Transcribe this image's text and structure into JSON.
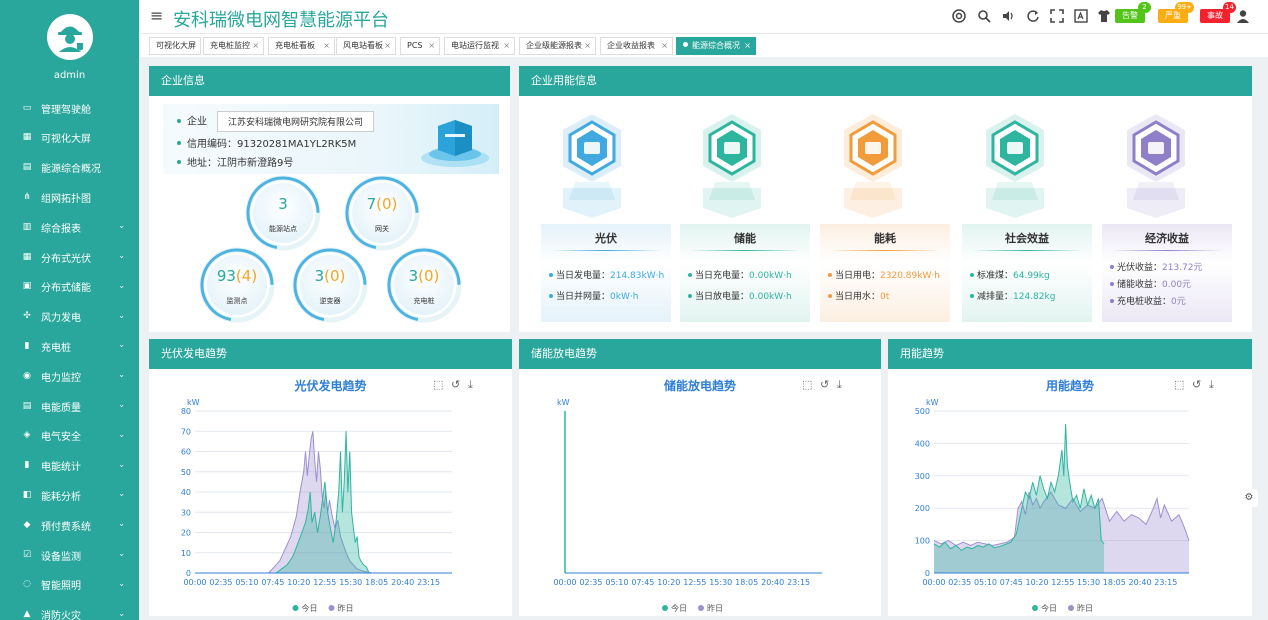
{
  "user": {
    "name": "admin"
  },
  "sidebar": {
    "items": [
      {
        "label": "管理驾驶舱",
        "icon": "monitor-icon",
        "chev": false
      },
      {
        "label": "可视化大屏",
        "icon": "screen-chart-icon",
        "chev": false
      },
      {
        "label": "能源综合概况",
        "icon": "grid-doc-icon",
        "chev": false
      },
      {
        "label": "组网拓扑图",
        "icon": "topology-icon",
        "chev": false
      },
      {
        "label": "综合报表",
        "icon": "report-icon",
        "chev": true
      },
      {
        "label": "分布式光伏",
        "icon": "solar-icon",
        "chev": true
      },
      {
        "label": "分布式储能",
        "icon": "battery-icon",
        "chev": true
      },
      {
        "label": "风力发电",
        "icon": "wind-icon",
        "chev": true
      },
      {
        "label": "充电桩",
        "icon": "charger-icon",
        "chev": true
      },
      {
        "label": "电力监控",
        "icon": "power-monitor-icon",
        "chev": true
      },
      {
        "label": "电能质量",
        "icon": "quality-icon",
        "chev": true
      },
      {
        "label": "电气安全",
        "icon": "safety-icon",
        "chev": true
      },
      {
        "label": "电能统计",
        "icon": "bar-stats-icon",
        "chev": true
      },
      {
        "label": "能耗分析",
        "icon": "analysis-icon",
        "chev": true
      },
      {
        "label": "预付费系统",
        "icon": "prepay-icon",
        "chev": true
      },
      {
        "label": "设备监测",
        "icon": "device-check-icon",
        "chev": true
      },
      {
        "label": "智能照明",
        "icon": "bulb-icon",
        "chev": true
      },
      {
        "label": "消防火灾",
        "icon": "fire-icon",
        "chev": true
      }
    ]
  },
  "header": {
    "title": "安科瑞微电网智慧能源平台",
    "badges": [
      {
        "label": "告警",
        "count": "2",
        "color": "#52c41a",
        "count_color": "#52c41a"
      },
      {
        "label": "严重",
        "count": "99+",
        "color": "#faad14",
        "count_color": "#faad14"
      },
      {
        "label": "事故",
        "count": "14",
        "color": "#f5222d",
        "count_color": "#f5222d"
      }
    ]
  },
  "tabs": [
    {
      "label": "可视化大屏",
      "closable": false
    },
    {
      "label": "充电桩监控",
      "closable": true
    },
    {
      "label": "充电桩看板",
      "closable": true
    },
    {
      "label": "风电站看板",
      "closable": true
    },
    {
      "label": "PCS",
      "closable": true
    },
    {
      "label": "电站运行监视",
      "closable": true
    },
    {
      "label": "企业级能源报表",
      "closable": true
    },
    {
      "label": "企业收益报表",
      "closable": true
    },
    {
      "label": "能源综合概况",
      "closable": true,
      "active": true
    }
  ],
  "enterprise": {
    "header": "企业信息",
    "name_label": "企业",
    "name": "江苏安科瑞微电网研究院有限公司",
    "credit_code": "信用编码：91320281MA1YL2RK5M",
    "address": "地址：江阴市新澄路9号"
  },
  "bubbles": [
    {
      "value": "3",
      "extra": "",
      "label": "能源站点",
      "progress": 0.72
    },
    {
      "value": "7",
      "extra": "0",
      "label": "网关",
      "progress": 0.72
    },
    {
      "value": "93",
      "extra": "4",
      "label": "监测点",
      "progress": 0.72
    },
    {
      "value": "3",
      "extra": "0",
      "label": "逆变器",
      "progress": 0.72
    },
    {
      "value": "3",
      "extra": "0",
      "label": "充电桩",
      "progress": 0.72
    }
  ],
  "energy_info": {
    "header": "企业用能信息",
    "panels": [
      {
        "title": "光伏",
        "icon": "solar-panel-icon",
        "color": "#3fa9e0",
        "rows": [
          {
            "label": "当日发电量：",
            "value": "214.83kW·h"
          },
          {
            "label": "当日并网量：",
            "value": "0kW·h"
          }
        ]
      },
      {
        "title": "储能",
        "icon": "storage-battery-icon",
        "color": "#2eb5a0",
        "rows": [
          {
            "label": "当日充电量：",
            "value": "0.00kW·h"
          },
          {
            "label": "当日放电量：",
            "value": "0.00kW·h"
          }
        ]
      },
      {
        "title": "能耗",
        "icon": "lightning-icon",
        "color": "#f29b3b",
        "rows": [
          {
            "label": "当日用电：",
            "value": "2320.89kW·h"
          },
          {
            "label": "当日用水：",
            "value": "0t"
          }
        ]
      },
      {
        "title": "社会效益",
        "icon": "eco-heart-icon",
        "color": "#2eb5a0",
        "rows": [
          {
            "label": "标准煤：",
            "value": "64.99kg"
          },
          {
            "label": "减排量：",
            "value": "124.82kg"
          }
        ]
      },
      {
        "title": "经济收益",
        "icon": "money-bag-icon",
        "color": "#8f7fc8",
        "rows": [
          {
            "label": "光伏收益：",
            "value": "213.72元"
          },
          {
            "label": "储能收益：",
            "value": "0.00元"
          },
          {
            "label": "充电桩收益：",
            "value": "0元"
          }
        ]
      }
    ]
  },
  "chart_data": [
    {
      "type": "area",
      "panel_header": "光伏发电趋势",
      "title": "光伏发电趋势",
      "ylabel": "kW",
      "ylim": [
        0,
        80
      ],
      "yticks": [
        0,
        10,
        20,
        30,
        40,
        50,
        60,
        70,
        80
      ],
      "xticks": [
        "00:00",
        "02:35",
        "05:10",
        "07:45",
        "10:20",
        "12:55",
        "15:30",
        "18:05",
        "20:40",
        "23:15"
      ],
      "x_range": [
        0,
        1395
      ],
      "legend": [
        "今日",
        "昨日"
      ],
      "series": [
        {
          "name": "今日",
          "color": "#2eb5a0",
          "points": [
            [
              440,
              0
            ],
            [
              470,
              2
            ],
            [
              500,
              4
            ],
            [
              530,
              8
            ],
            [
              560,
              15
            ],
            [
              580,
              20
            ],
            [
              600,
              25
            ],
            [
              615,
              32
            ],
            [
              625,
              40
            ],
            [
              635,
              25
            ],
            [
              650,
              30
            ],
            [
              665,
              20
            ],
            [
              680,
              28
            ],
            [
              695,
              38
            ],
            [
              705,
              45
            ],
            [
              720,
              30
            ],
            [
              735,
              22
            ],
            [
              750,
              15
            ],
            [
              765,
              25
            ],
            [
              780,
              40
            ],
            [
              790,
              60
            ],
            [
              800,
              30
            ],
            [
              810,
              45
            ],
            [
              820,
              70
            ],
            [
              830,
              40
            ],
            [
              840,
              60
            ],
            [
              850,
              30
            ],
            [
              860,
              22
            ],
            [
              870,
              15
            ],
            [
              880,
              18
            ],
            [
              890,
              8
            ],
            [
              900,
              6
            ],
            [
              915,
              4
            ],
            [
              930,
              3
            ],
            [
              945,
              0
            ]
          ]
        },
        {
          "name": "昨日",
          "color": "#9f8fd0",
          "points": [
            [
              400,
              0
            ],
            [
              430,
              3
            ],
            [
              460,
              6
            ],
            [
              490,
              12
            ],
            [
              520,
              18
            ],
            [
              550,
              28
            ],
            [
              570,
              40
            ],
            [
              590,
              50
            ],
            [
              600,
              60
            ],
            [
              610,
              48
            ],
            [
              620,
              58
            ],
            [
              630,
              66
            ],
            [
              640,
              70
            ],
            [
              650,
              55
            ],
            [
              660,
              45
            ],
            [
              670,
              60
            ],
            [
              680,
              52
            ],
            [
              690,
              38
            ],
            [
              700,
              32
            ],
            [
              710,
              40
            ],
            [
              720,
              30
            ],
            [
              730,
              36
            ],
            [
              745,
              28
            ],
            [
              760,
              22
            ],
            [
              775,
              26
            ],
            [
              790,
              18
            ],
            [
              805,
              14
            ],
            [
              820,
              10
            ],
            [
              840,
              6
            ],
            [
              860,
              4
            ],
            [
              880,
              2
            ],
            [
              910,
              1
            ],
            [
              960,
              0
            ]
          ]
        }
      ]
    },
    {
      "type": "area",
      "panel_header": "储能放电趋势",
      "title": "储能放电趋势",
      "ylabel": "kW",
      "xticks": [
        "00:00",
        "02:35",
        "05:10",
        "07:45",
        "10:20",
        "12:55",
        "15:30",
        "18:05",
        "20:40",
        "23:15"
      ],
      "legend": [
        "今日",
        "昨日"
      ],
      "series": []
    },
    {
      "type": "area",
      "panel_header": "用能趋势",
      "title": "用能趋势",
      "ylabel": "kW",
      "ylim": [
        0,
        500
      ],
      "yticks": [
        0,
        100,
        200,
        300,
        400,
        500
      ],
      "xticks": [
        "00:00",
        "02:35",
        "05:10",
        "07:45",
        "10:20",
        "12:55",
        "15:30",
        "18:05",
        "20:40",
        "23:15"
      ],
      "x_range": [
        0,
        1395
      ],
      "legend": [
        "今日",
        "昨日"
      ],
      "series": [
        {
          "name": "今日",
          "color": "#2eb5a0",
          "points": [
            [
              0,
              90
            ],
            [
              30,
              80
            ],
            [
              60,
              95
            ],
            [
              90,
              75
            ],
            [
              120,
              85
            ],
            [
              150,
              70
            ],
            [
              180,
              80
            ],
            [
              210,
              75
            ],
            [
              240,
              85
            ],
            [
              270,
              80
            ],
            [
              300,
              90
            ],
            [
              330,
              78
            ],
            [
              360,
              82
            ],
            [
              390,
              88
            ],
            [
              420,
              95
            ],
            [
              450,
              120
            ],
            [
              480,
              200
            ],
            [
              500,
              250
            ],
            [
              520,
              230
            ],
            [
              540,
              280
            ],
            [
              560,
              240
            ],
            [
              580,
              300
            ],
            [
              600,
              260
            ],
            [
              620,
              230
            ],
            [
              640,
              280
            ],
            [
              660,
              250
            ],
            [
              680,
              300
            ],
            [
              700,
              380
            ],
            [
              710,
              300
            ],
            [
              720,
              460
            ],
            [
              730,
              330
            ],
            [
              745,
              270
            ],
            [
              760,
              220
            ],
            [
              780,
              240
            ],
            [
              800,
              200
            ],
            [
              820,
              260
            ],
            [
              840,
              210
            ],
            [
              860,
              240
            ],
            [
              880,
              200
            ],
            [
              900,
              230
            ],
            [
              915,
              100
            ],
            [
              930,
              90
            ]
          ]
        },
        {
          "name": "昨日",
          "color": "#9f8fd0",
          "points": [
            [
              0,
              100
            ],
            [
              40,
              90
            ],
            [
              80,
              100
            ],
            [
              120,
              85
            ],
            [
              160,
              95
            ],
            [
              200,
              85
            ],
            [
              240,
              95
            ],
            [
              280,
              90
            ],
            [
              320,
              85
            ],
            [
              360,
              90
            ],
            [
              400,
              95
            ],
            [
              440,
              110
            ],
            [
              460,
              200
            ],
            [
              480,
              220
            ],
            [
              500,
              180
            ],
            [
              520,
              250
            ],
            [
              540,
              210
            ],
            [
              560,
              230
            ],
            [
              580,
              200
            ],
            [
              600,
              220
            ],
            [
              640,
              250
            ],
            [
              680,
              210
            ],
            [
              720,
              200
            ],
            [
              760,
              230
            ],
            [
              800,
              190
            ],
            [
              840,
              210
            ],
            [
              880,
              200
            ],
            [
              920,
              230
            ],
            [
              960,
              160
            ],
            [
              1000,
              190
            ],
            [
              1040,
              160
            ],
            [
              1080,
              180
            ],
            [
              1120,
              170
            ],
            [
              1160,
              150
            ],
            [
              1200,
              200
            ],
            [
              1220,
              230
            ],
            [
              1240,
              170
            ],
            [
              1260,
              210
            ],
            [
              1300,
              160
            ],
            [
              1340,
              180
            ],
            [
              1370,
              140
            ],
            [
              1395,
              100
            ]
          ]
        }
      ]
    }
  ]
}
